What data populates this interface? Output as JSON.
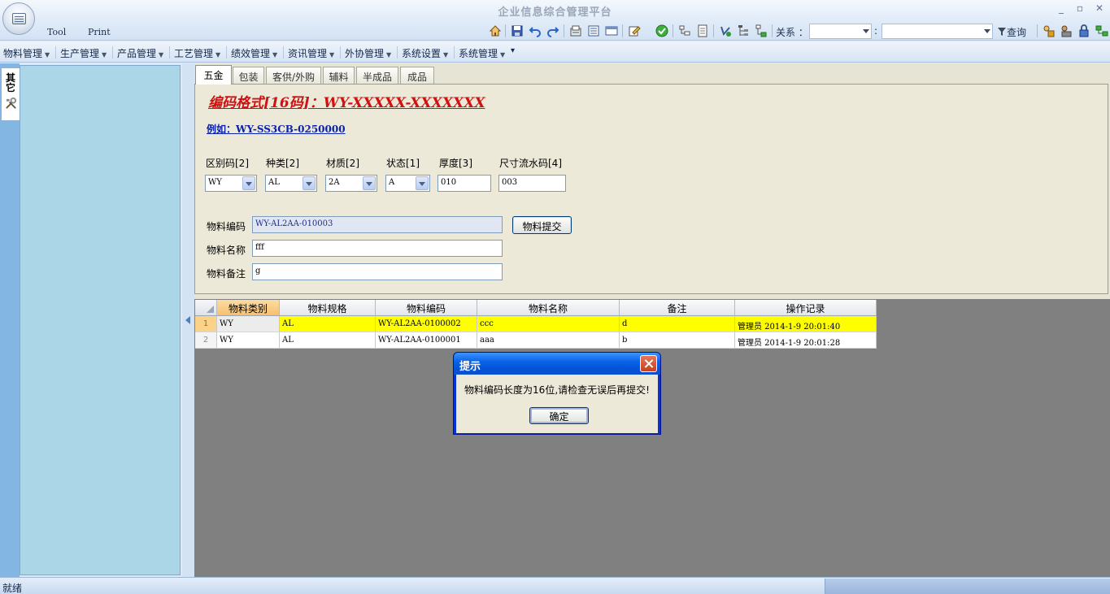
{
  "app": {
    "title": "企业信息综合管理平台"
  },
  "window_controls": {
    "minimize": "_",
    "restore": "▫",
    "close": "✕"
  },
  "quick_menu": {
    "tool": "Tool",
    "print": "Print"
  },
  "toolbar": {
    "icons": [
      "home-icon",
      "save-icon",
      "undo-icon",
      "redo-icon",
      "export-icon",
      "list-view-icon",
      "card-view-icon",
      "edit-icon",
      "confirm-icon",
      "tree-icon",
      "doc-icon",
      "refresh-icon",
      "hierarchy-icon",
      "tree-add-icon"
    ],
    "relation_label": "关系 ：",
    "colon": ":",
    "query_label": "查询",
    "right_icons": [
      "lock-icon",
      "users-icon",
      "padlock-icon",
      "network-icon"
    ]
  },
  "menubar": {
    "items": [
      "物料管理",
      "生产管理",
      "产品管理",
      "工艺管理",
      "绩效管理",
      "资讯管理",
      "外协管理",
      "系统设置",
      "系统管理"
    ],
    "overflow": "▾"
  },
  "left_tab": {
    "label": "其它"
  },
  "tabs": [
    "五金",
    "包装",
    "客供/外购",
    "辅料",
    "半成品",
    "成品"
  ],
  "form": {
    "code_format": "编码格式[16码]：WY-XXXXX-XXXXXXX",
    "example": "例如：WY-SS3CB-0250000",
    "fields": {
      "region": {
        "label": "区别码[2]",
        "value": "WY"
      },
      "kind": {
        "label": "种类[2]",
        "value": "AL"
      },
      "material": {
        "label": "材质[2]",
        "value": "2A"
      },
      "status": {
        "label": "状态[1]",
        "value": "A"
      },
      "thickness": {
        "label": "厚度[3]",
        "value": "010"
      },
      "size_serial": {
        "label": "尺寸流水码[4]",
        "value": "003"
      }
    },
    "material_code": {
      "label": "物料编码",
      "value": "WY-AL2AA-010003"
    },
    "material_name": {
      "label": "物料名称",
      "value": "fff"
    },
    "material_note": {
      "label": "物料备注",
      "value": "g"
    },
    "submit_label": "物料提交"
  },
  "grid": {
    "headers": [
      "物料类别",
      "物料规格",
      "物料编码",
      "物料名称",
      "备注",
      "操作记录"
    ],
    "rows": [
      {
        "num": "1",
        "cells": [
          "WY",
          "AL",
          "WY-AL2AA-0100002",
          "ccc",
          "d",
          "管理员 2014-1-9 20:01:40"
        ]
      },
      {
        "num": "2",
        "cells": [
          "WY",
          "AL",
          "WY-AL2AA-0100001",
          "aaa",
          "b",
          "管理员 2014-1-9 20:01:28"
        ]
      }
    ],
    "selected_row_color": "#ffff00"
  },
  "dialog": {
    "title": "提示",
    "message": "物料编码长度为16位,请检查无误后再提交!",
    "ok_label": "确定"
  },
  "statusbar": {
    "text": "就绪"
  },
  "colors": {
    "accent": "#0831d9",
    "title_red": "#d11111",
    "link_blue": "#0c22a8"
  }
}
